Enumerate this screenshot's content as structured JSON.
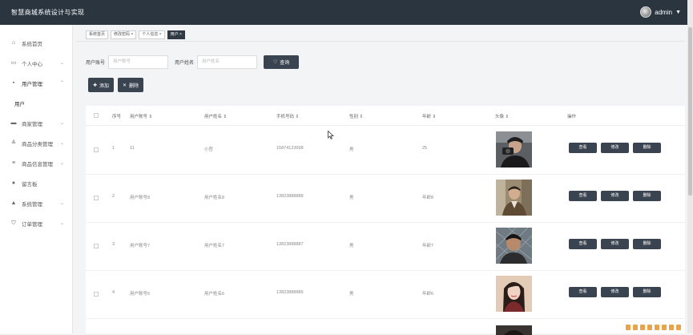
{
  "header": {
    "title": "智慧商城系统设计与实现",
    "user": "admin"
  },
  "sidebar": {
    "items": [
      {
        "label": "系统首页",
        "icon": "home-icon"
      },
      {
        "label": "个人中心",
        "icon": "calendar-icon"
      },
      {
        "label": "用户管理",
        "icon": "grid-icon"
      },
      {
        "label": "商家管理",
        "icon": "briefcase-icon"
      },
      {
        "label": "商品分类管理",
        "icon": "sliders-icon"
      },
      {
        "label": "商品信息管理",
        "icon": "list-icon"
      },
      {
        "label": "留言板",
        "icon": "pin-icon"
      },
      {
        "label": "系统管理",
        "icon": "person-icon"
      },
      {
        "label": "订单管理",
        "icon": "shield-icon"
      }
    ],
    "sub_item": "用户"
  },
  "tabs": [
    {
      "label": "系统首页"
    },
    {
      "label": "修改密码 ×"
    },
    {
      "label": "个人信息 ×"
    },
    {
      "label": "用户 ×"
    }
  ],
  "search": {
    "account_label": "用户账号",
    "account_placeholder": "用户账号",
    "name_label": "用户姓名",
    "name_placeholder": "用户姓名",
    "query": "查询"
  },
  "actions": {
    "add": "添加",
    "delete": "删除"
  },
  "table": {
    "headers": [
      "序号",
      "用户账号 ⇕",
      "用户姓名 ⇕",
      "手机号码 ⇕",
      "性别 ⇕",
      "年龄 ⇕",
      "头像 ⇕",
      "操作"
    ],
    "rows": [
      {
        "no": "1",
        "account": "11",
        "name": "小哲",
        "phone": "15874123698",
        "gender": "男",
        "age": "25",
        "photo": "man-camera"
      },
      {
        "no": "2",
        "account": "用户账号8",
        "name": "用户姓名8",
        "phone": "13823888888",
        "gender": "男",
        "age": "年龄8",
        "photo": "man-street"
      },
      {
        "no": "3",
        "account": "用户账号7",
        "name": "用户姓名7",
        "phone": "13823888887",
        "gender": "男",
        "age": "年龄7",
        "photo": "man-fence"
      },
      {
        "no": "4",
        "account": "用户账号6",
        "name": "用户姓名6",
        "phone": "13823888886",
        "gender": "男",
        "age": "年龄6",
        "photo": "woman-portrait"
      }
    ],
    "row_buttons": {
      "view": "查看",
      "edit": "修改",
      "delete": "删除"
    }
  },
  "colors": {
    "topbar": "#2b3540",
    "button": "#3a4350",
    "accent_tab": "#2f3a45"
  }
}
